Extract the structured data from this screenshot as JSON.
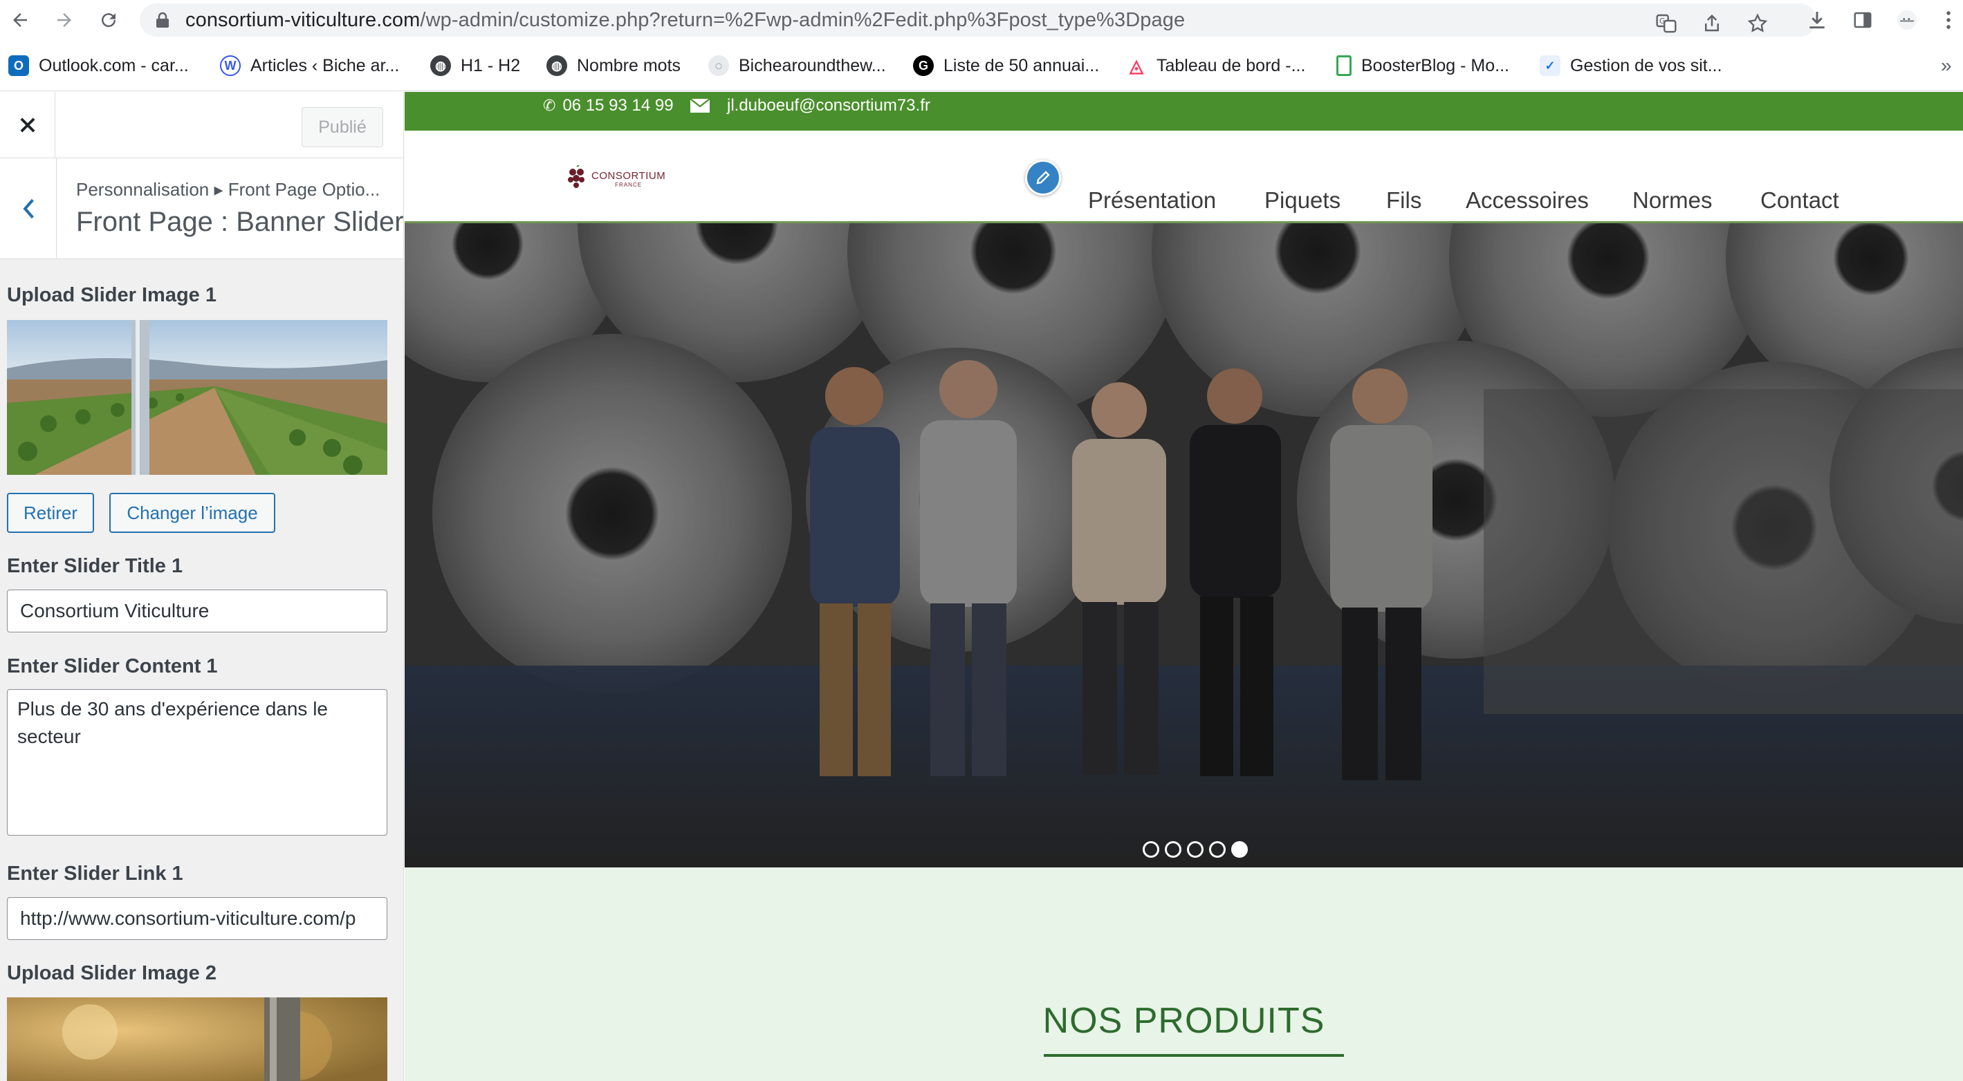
{
  "browser": {
    "url_host": "consortium-viticulture.com",
    "url_path": "/wp-admin/customize.php?return=%2Fwp-admin%2Fedit.php%3Fpost_type%3Dpage",
    "bookmarks": [
      {
        "label": "Outlook.com - car...",
        "icon": "outlook-icon",
        "color": "#0f6cbd"
      },
      {
        "label": "Articles ‹ Biche ar...",
        "icon": "wordpress-icon",
        "color": "#3858e9"
      },
      {
        "label": "H1 - H2",
        "icon": "globe-icon",
        "color": "#5f6368"
      },
      {
        "label": "Nombre mots",
        "icon": "globe-icon",
        "color": "#5f6368"
      },
      {
        "label": "Bichearoundthew...",
        "icon": "site-icon",
        "color": "#9aa0a6"
      },
      {
        "label": "Liste de 50 annuai...",
        "icon": "g-icon",
        "color": "#000000"
      },
      {
        "label": "Tableau de bord -...",
        "icon": "airbnb-icon",
        "color": "#ff385c"
      },
      {
        "label": "BoosterBlog - Mo...",
        "icon": "boosterblog-icon",
        "color": "#34a853"
      },
      {
        "label": "Gestion de vos sit...",
        "icon": "site-manager-icon",
        "color": "#1a73e8"
      }
    ],
    "more_label": "»"
  },
  "customizer": {
    "publish_label": "Publié",
    "breadcrumb": "Personnalisation ▸ Front Page Optio...",
    "section_title": "Front Page : Banner Slider",
    "controls": {
      "image1_label": "Upload Slider Image 1",
      "remove_label": "Retirer",
      "change_label": "Changer l’image",
      "title1_label": "Enter Slider Title 1",
      "title1_value": "Consortium Viticulture",
      "content1_label": "Enter Slider Content 1",
      "content1_value": "Plus de 30 ans d'expérience dans le secteur",
      "link1_label": "Enter Slider Link 1",
      "link1_value": "http://www.consortium-viticulture.com/p",
      "image2_label": "Upload Slider Image 2"
    }
  },
  "site": {
    "phone": "06 15 93 14 99",
    "email": "jl.duboeuf@consortium73.fr",
    "logo_text": "CONSORTIUM",
    "logo_subtext": "FRANCE",
    "menu": [
      "Présentation",
      "Piquets",
      "Fils",
      "Accessoires",
      "Normes",
      "Contact"
    ],
    "slider_active_index": 5,
    "slider_count": 5,
    "section_title": "NOS PRODUITS"
  },
  "colors": {
    "topbar_green": "#4a8f2d",
    "wp_blue": "#2271b1",
    "section_green": "#2e6b2e"
  }
}
